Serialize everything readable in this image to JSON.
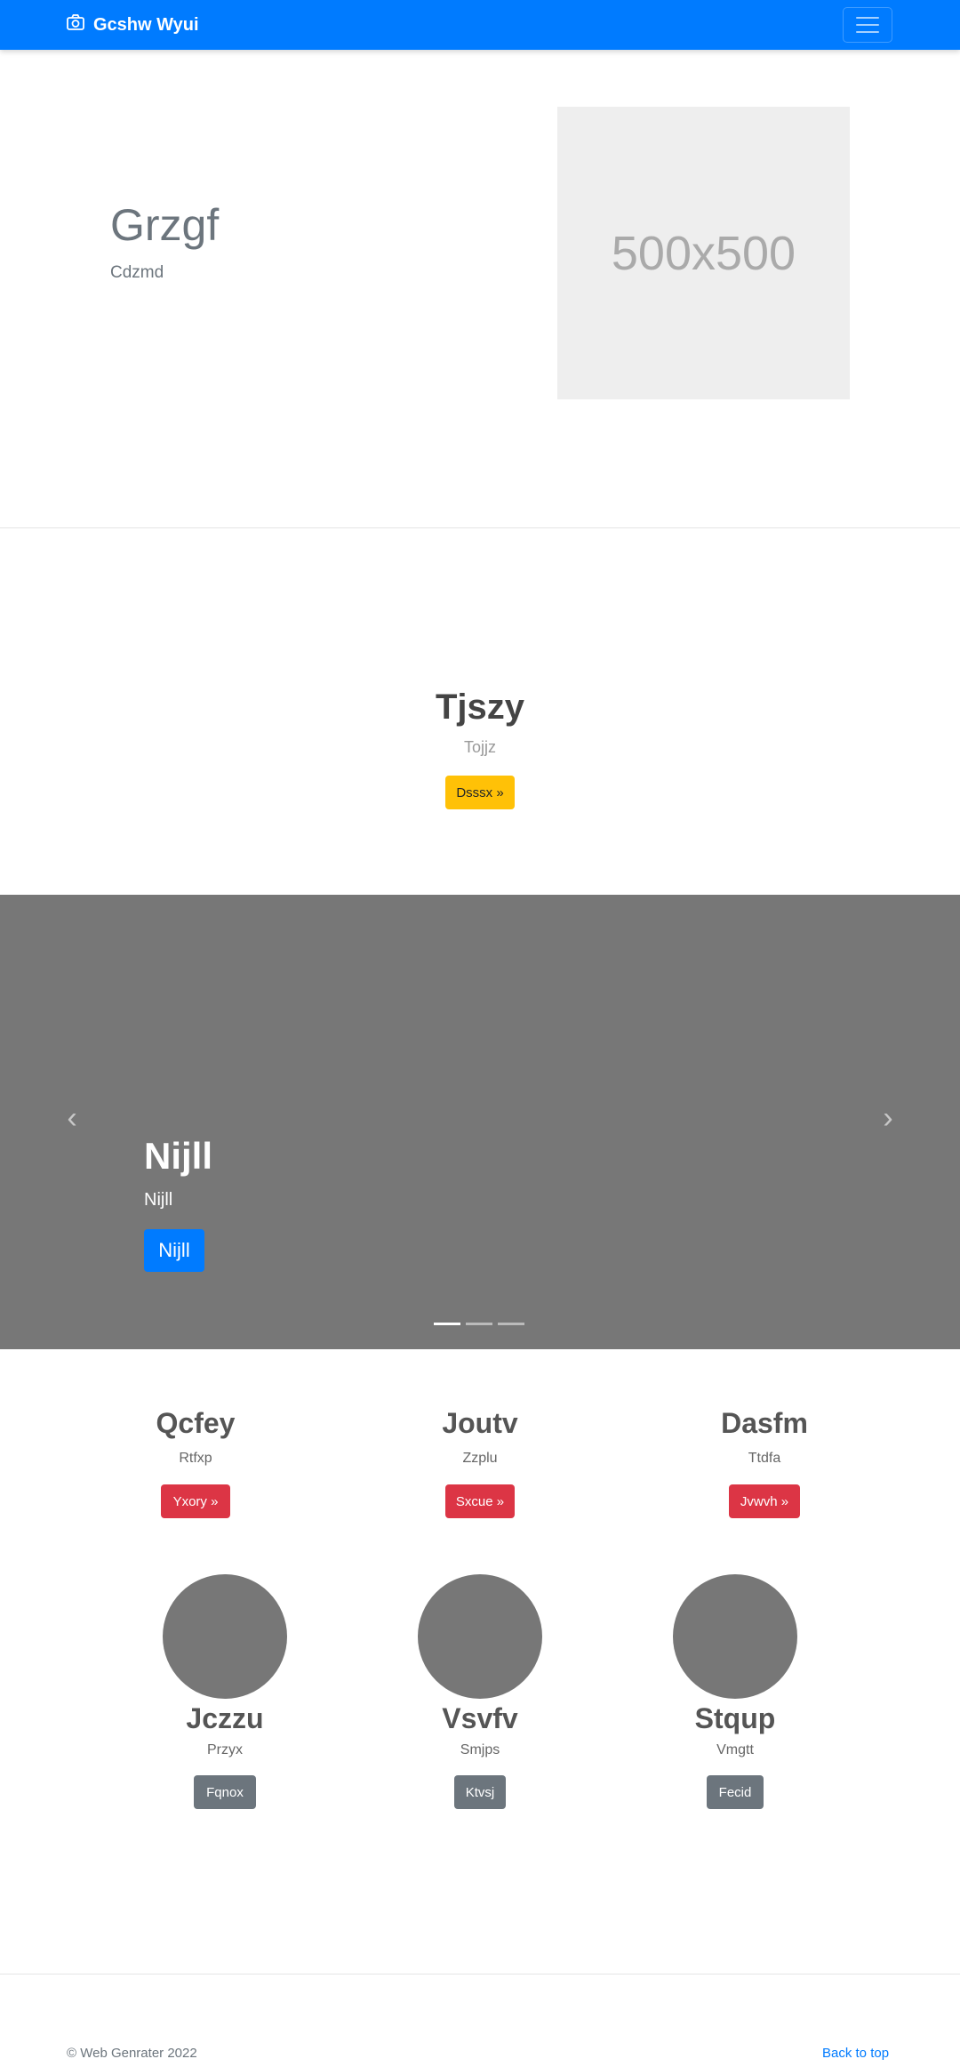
{
  "navbar": {
    "brand": "Gcshw Wyui",
    "brand_icon": "camera-icon",
    "toggle_icon": "hamburger-icon",
    "color": "#007bff"
  },
  "hero": {
    "title": "Grzgf",
    "subtitle": "Cdzmd",
    "placeholder": "500x500"
  },
  "feature": {
    "title": "Tjszy",
    "subtitle": "Tojjz",
    "button": "Dsssx »"
  },
  "carousel": {
    "title": "Nijll",
    "subtitle": "Nijll",
    "button": "Nijll",
    "prev_icon": "chevron-left-icon",
    "next_icon": "chevron-right-icon",
    "slide_count": 3,
    "active_slide": 1
  },
  "columns": [
    {
      "title": "Qcfey",
      "subtitle": "Rtfxp",
      "button": "Yxory »"
    },
    {
      "title": "Joutv",
      "subtitle": "Zzplu",
      "button": "Sxcue »"
    },
    {
      "title": "Dasfm",
      "subtitle": "Ttdfa",
      "button": "Jvwvh »"
    }
  ],
  "team": [
    {
      "name": "Jczzu",
      "subtitle": "Przyx",
      "button": "Fqnox"
    },
    {
      "name": "Vsvfv",
      "subtitle": "Smjps",
      "button": "Ktvsj"
    },
    {
      "name": "Stqup",
      "subtitle": "Vmgtt",
      "button": "Fecid"
    }
  ],
  "footer": {
    "copyright": "© Web Genrater 2022",
    "back_to_top": "Back to top"
  }
}
